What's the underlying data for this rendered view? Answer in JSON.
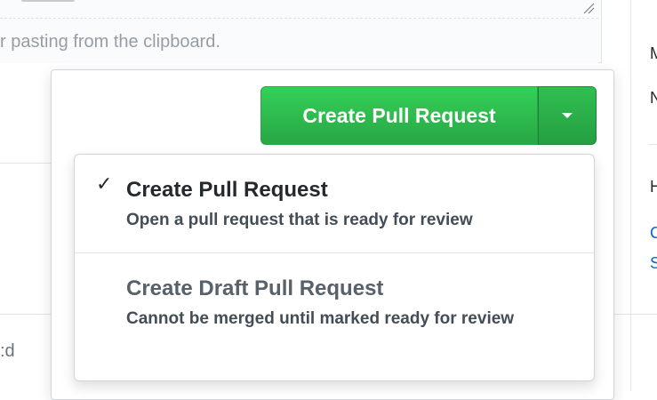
{
  "editor": {
    "hint_text": "r pasting from the clipboard."
  },
  "background": {
    "left_bottom_text": ":d",
    "side_letters": [
      "M",
      "N",
      "H",
      "C",
      "S"
    ]
  },
  "create_button": {
    "label": "Create Pull Request",
    "dropdown_icon": "caret-down-icon",
    "color": "#28a745"
  },
  "menu": {
    "items": [
      {
        "title": "Create Pull Request",
        "description": "Open a pull request that is ready for review",
        "selected": true,
        "check_icon": "check-icon",
        "check_glyph": "✓"
      },
      {
        "title": "Create Draft Pull Request",
        "description": "Cannot be merged until marked ready for review",
        "selected": false
      }
    ]
  }
}
